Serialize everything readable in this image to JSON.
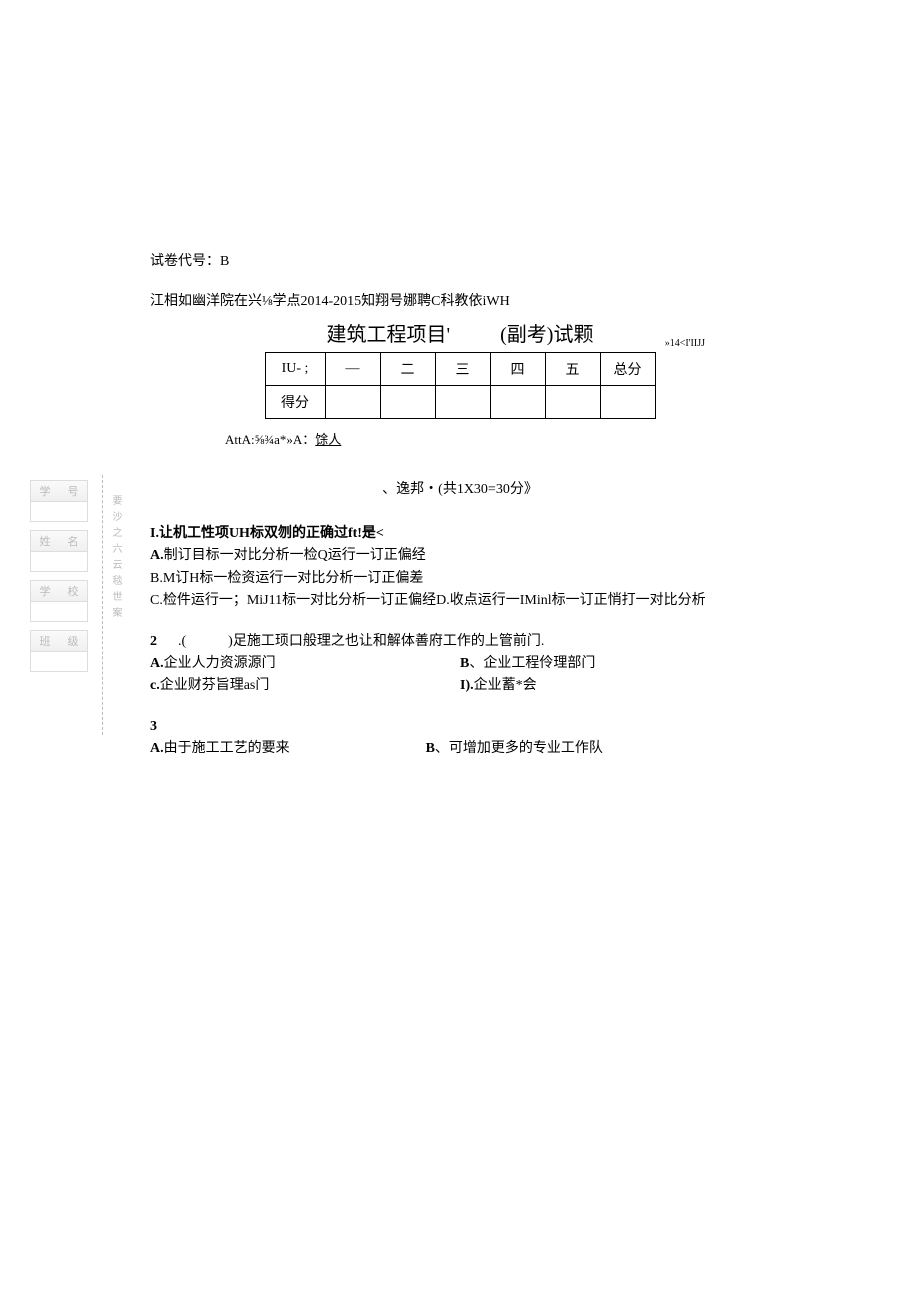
{
  "paper_code": "试卷代号：B",
  "school_info": "江相如幽洋院在兴⅛学点2014-2015知翔号娜聘C科教依iWH",
  "main_title": "建筑工程项目'",
  "sub_title": "(副考)试颗",
  "small_note": "»14<I'IIJJ",
  "score_table": {
    "row1": [
      "IU- ;",
      "—",
      "二",
      "三",
      "四",
      "五",
      "总分"
    ],
    "row2_label": "得分"
  },
  "proposer_label": "AttA:⅝¾a*»A：",
  "proposer_name": "馀人",
  "section_title": "、逸邦・(共1X30=30分》",
  "questions": {
    "q1": {
      "stem": "I.让机工性项UH标双刎的正确过ft!是<",
      "optA": "A.制订目标一对比分析一检Q运行一订正偏经",
      "optB": "B.M订H标一检资运行一对比分析一订正偏差",
      "optC": "C.检件运行一；MiJ11标一对比分析一订正偏经D.收点运行一IMinl标一订正悄打一对比分析"
    },
    "q2": {
      "num": "2",
      "stem": ".(　　　)足施工顼口般理之也让和解体善府工作的上管前门.",
      "optA_label": "A.",
      "optA": "企业人力资源源门",
      "optB_label": "B",
      "optB": "、企业工程伶理部门",
      "optC_label": "c.",
      "optC": "企业财芬旨理as门",
      "optD_label": "I).",
      "optD": "企业蓄*会"
    },
    "q3": {
      "num": "3",
      "optA_label": "A.",
      "optA": "由于施工工艺的要来",
      "optB_label": "B",
      "optB": "、可增加更多的专业工作队"
    }
  },
  "sidebar": {
    "item1": [
      "学",
      "号"
    ],
    "item2": [
      "姓",
      "名"
    ],
    "item3": [
      "学",
      "校"
    ],
    "item4": [
      "班",
      "级"
    ]
  },
  "vertical_chars": "要沙之六云毯世案"
}
